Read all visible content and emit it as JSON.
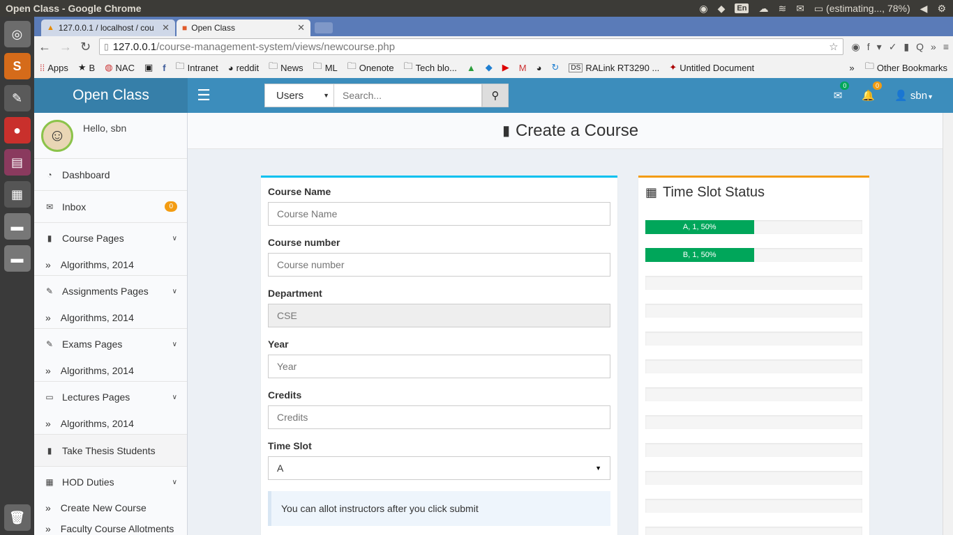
{
  "os": {
    "window_title": "Open Class - Google Chrome",
    "lang": "En",
    "battery": "(estimating..., 78%)"
  },
  "browser": {
    "tabs": [
      {
        "title": "127.0.0.1 / localhost / cou"
      },
      {
        "title": "Open Class"
      }
    ],
    "url_host": "127.0.0.1",
    "url_path": "/course-management-system/views/newcourse.php",
    "bookmarks": [
      "Apps",
      "B",
      "NAC",
      "Intranet",
      "reddit",
      "News",
      "ML",
      "Onenote",
      "Tech blo...",
      "RALink RT3290 ...",
      "Untitled Document"
    ],
    "other_bookmarks": "Other Bookmarks"
  },
  "header": {
    "logo": "Open Class",
    "search_select": "Users",
    "search_placeholder": "Search...",
    "mail_count": "0",
    "notif_count": "0",
    "username": "sbn"
  },
  "sidebar": {
    "hello": "Hello, sbn",
    "dashboard": "Dashboard",
    "inbox": "Inbox",
    "inbox_count": "0",
    "course_pages": "Course Pages",
    "course_sub": "Algorithms, 2014",
    "assignments_pages": "Assignments Pages",
    "assignments_sub": "Algorithms, 2014",
    "exams_pages": "Exams Pages",
    "exams_sub": "Algorithms, 2014",
    "lectures_pages": "Lectures Pages",
    "lectures_sub": "Algorithms, 2014",
    "thesis": "Take Thesis Students",
    "hod": "HOD Duties",
    "hod_sub1": "Create New Course",
    "hod_sub2": "Faculty Course Allotments"
  },
  "page": {
    "title": "Create a Course"
  },
  "form": {
    "course_name_label": "Course Name",
    "course_name_placeholder": "Course Name",
    "course_number_label": "Course number",
    "course_number_placeholder": "Course number",
    "department_label": "Department",
    "department_value": "CSE",
    "year_label": "Year",
    "year_placeholder": "Year",
    "credits_label": "Credits",
    "credits_placeholder": "Credits",
    "timeslot_label": "Time Slot",
    "timeslot_value": "A",
    "callout": "You can allot instructors after you click submit"
  },
  "timeslots": {
    "title": "Time Slot Status",
    "bars": [
      {
        "label": "A, 1, 50%",
        "percent": 50
      },
      {
        "label": "B, 1, 50%",
        "percent": 50
      },
      {
        "label": "",
        "percent": 0
      },
      {
        "label": "",
        "percent": 0
      },
      {
        "label": "",
        "percent": 0
      },
      {
        "label": "",
        "percent": 0
      },
      {
        "label": "",
        "percent": 0
      },
      {
        "label": "",
        "percent": 0
      },
      {
        "label": "",
        "percent": 0
      },
      {
        "label": "",
        "percent": 0
      },
      {
        "label": "",
        "percent": 0
      },
      {
        "label": "",
        "percent": 0
      }
    ]
  },
  "colors": {
    "header": "#3c8dbc",
    "logo_bg": "#367fa9",
    "progress": "#00a65a",
    "badge_orange": "#f39c12",
    "badge_green": "#00a65a",
    "form_top": "#00c0ef"
  }
}
